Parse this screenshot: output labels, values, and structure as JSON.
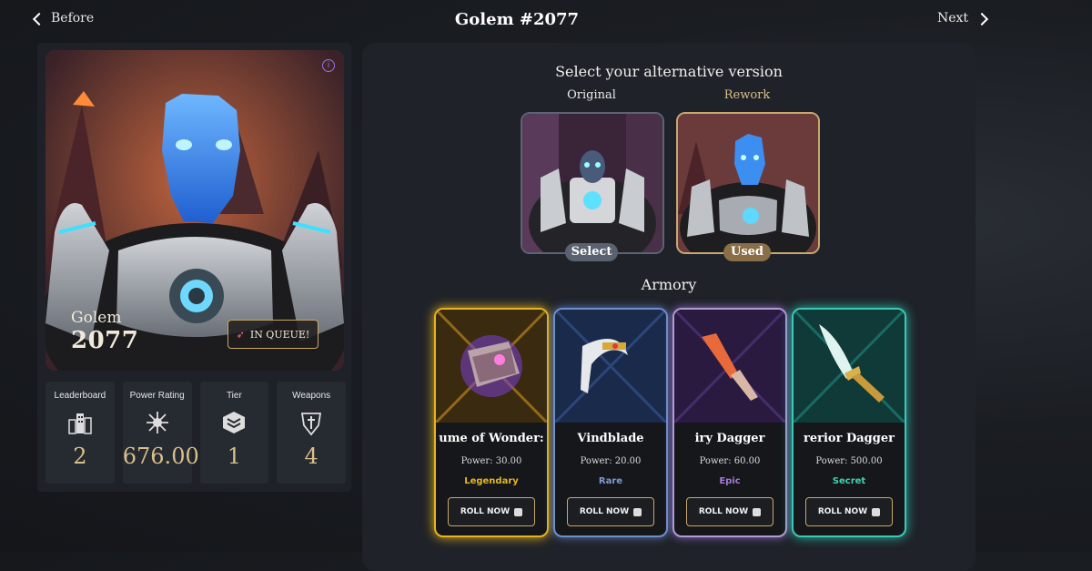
{
  "nav": {
    "before_label": "Before",
    "next_label": "Next"
  },
  "page": {
    "title": "Golem #2077"
  },
  "hero": {
    "name": "Golem",
    "number": "2077",
    "queue_label": "IN QUEUE!"
  },
  "stats": [
    {
      "label": "Leaderboard",
      "value": "2",
      "icon": "buildings-icon"
    },
    {
      "label": "Power Rating",
      "value": "676.00",
      "icon": "burst-icon"
    },
    {
      "label": "Tier",
      "value": "1",
      "icon": "tier-badge-icon"
    },
    {
      "label": "Weapons",
      "value": "4",
      "icon": "weapon-shield-icon"
    }
  ],
  "versions": {
    "title": "Select your alternative version",
    "original": {
      "label": "Original",
      "button": "Select"
    },
    "rework": {
      "label": "Rework",
      "button": "Used"
    }
  },
  "armory": {
    "title": "Armory",
    "roll_label": "ROLL NOW",
    "items": [
      {
        "name": "ume of Wonder:",
        "power": "Power: 30.00",
        "rarity": "Legendary",
        "rarity_color": "#e3b629",
        "border_color": "#e6b41e"
      },
      {
        "name": "Vindblade",
        "power": "Power: 20.00",
        "rarity": "Rare",
        "rarity_color": "#7c9bd8",
        "border_color": "#6f8fc8"
      },
      {
        "name": "iry Dagger",
        "power": "Power: 60.00",
        "rarity": "Epic",
        "rarity_color": "#a47ad6",
        "border_color": "#b29ad2"
      },
      {
        "name": "rerior Dagger",
        "power": "Power: 500.00",
        "rarity": "Secret",
        "rarity_color": "#3ed3b0",
        "border_color": "#3cc9b4"
      }
    ]
  }
}
